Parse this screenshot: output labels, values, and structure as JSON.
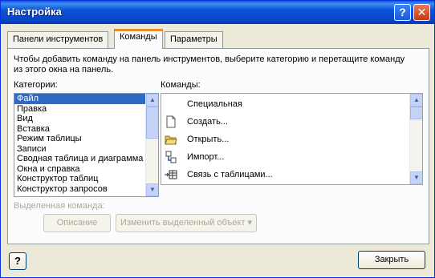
{
  "window": {
    "title": "Настройка"
  },
  "caption_buttons": {
    "help": "?",
    "close": "✕"
  },
  "tabs": [
    {
      "label": "Панели инструментов",
      "active": false
    },
    {
      "label": "Команды",
      "active": true
    },
    {
      "label": "Параметры",
      "active": false
    }
  ],
  "instructions": "Чтобы добавить команду на панель инструментов, выберите категорию и перетащите команду из этого окна на панель.",
  "categories": {
    "label": "Категории:",
    "items": [
      "Файл",
      "Правка",
      "Вид",
      "Вставка",
      "Режим таблицы",
      "Записи",
      "Сводная таблица и диаграмма",
      "Окна и справка",
      "Конструктор таблиц",
      "Конструктор запросов"
    ],
    "selected_index": 0
  },
  "commands": {
    "label": "Команды:",
    "items": [
      {
        "label": "Специальная",
        "icon": ""
      },
      {
        "label": "Создать...",
        "icon": "new-document-icon"
      },
      {
        "label": "Открыть...",
        "icon": "open-folder-icon"
      },
      {
        "label": "Импорт...",
        "icon": "import-icon"
      },
      {
        "label": "Связь с таблицами...",
        "icon": "link-tables-icon"
      }
    ]
  },
  "selected_command": {
    "label": "Выделенная команда:",
    "description_button": "Описание",
    "modify_button": "Изменить выделенный объект",
    "modify_arrow": "▾"
  },
  "footer": {
    "help_icon": "?",
    "close_button": "Закрыть"
  }
}
